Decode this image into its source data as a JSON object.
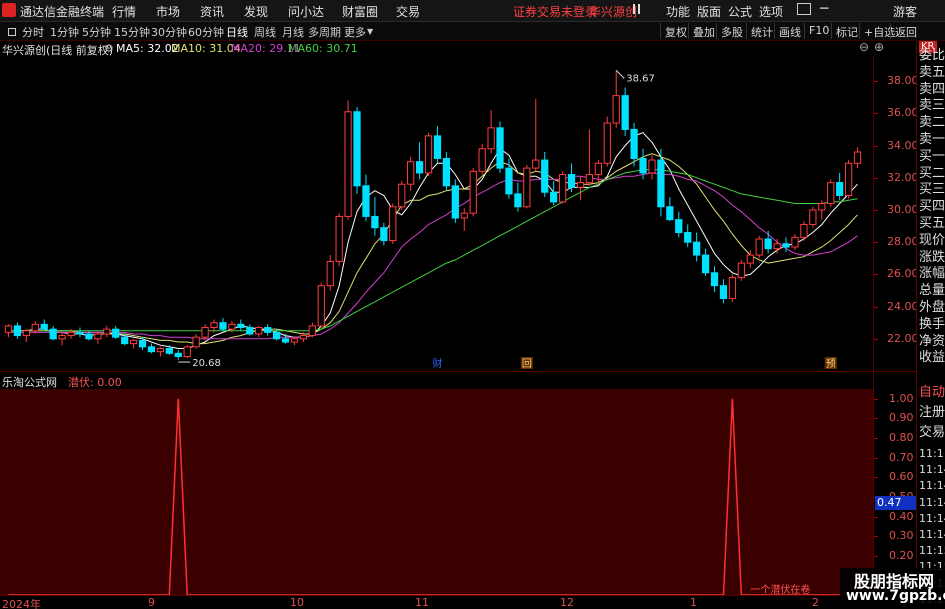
{
  "titlebar": {
    "app_name": "通达信金融终端",
    "menus": [
      "行情",
      "市场",
      "资讯",
      "发现",
      "问小达",
      "财富圈",
      "交易"
    ],
    "alert": "证券交易未登录",
    "stock_name": "华兴源创",
    "right_menus": [
      "功能",
      "版面",
      "公式",
      "选项"
    ],
    "guest": "游客"
  },
  "toolbar": {
    "periods": [
      "分时",
      "1分钟",
      "5分钟",
      "15分钟",
      "30分钟",
      "60分钟",
      "日线",
      "周线",
      "月线",
      "多周期",
      "更多"
    ],
    "active_period": "日线",
    "right_buttons": [
      "复权",
      "叠加",
      "多股",
      "统计",
      "画线",
      "F10",
      "标记",
      "+自选",
      "返回"
    ]
  },
  "main_chart": {
    "title": "华兴源创(日线 前复权)",
    "ma5": "MA5: 32.02",
    "ma10": "MA10: 31.04",
    "ma20": "MA20: 29.11",
    "ma60": "MA60: 30.71",
    "high_label": "38.67",
    "low_label": "20.68",
    "markers": [
      "财",
      "回",
      "预"
    ],
    "y_ticks": [
      "38.00",
      "36.00",
      "34.00",
      "32.00",
      "30.00",
      "28.00",
      "26.00",
      "24.00",
      "22.00"
    ],
    "colors": {
      "ma5": "#ffffff",
      "ma10": "#e0e070",
      "ma20": "#d040d0",
      "ma60": "#40d040",
      "up": "#ff3c3c",
      "down": "#00e0ff"
    }
  },
  "sub_chart": {
    "title": "乐淘公式网",
    "series_label": "潜伏: 0.00",
    "y_ticks": [
      "1.00",
      "0.90",
      "0.80",
      "0.70",
      "0.60",
      "0.50",
      "0.40",
      "0.30",
      "0.20"
    ],
    "current_value": "0.47",
    "annotation": "一个潜伏在卷"
  },
  "x_axis": {
    "labels": [
      "2024年",
      "9",
      "10",
      "11",
      "12",
      "1",
      "2"
    ]
  },
  "right_panel": {
    "header": "KR",
    "items": [
      "委比",
      "卖五",
      "卖四",
      "卖三",
      "卖二",
      "卖一",
      "买一",
      "买二",
      "买三",
      "买四",
      "买五",
      "现价",
      "涨跌",
      "涨幅",
      "总量",
      "外盘",
      "换手",
      "净资",
      "收益"
    ],
    "items2": [
      "自动",
      "注册",
      "交易"
    ],
    "times": [
      "11:1",
      "11:14",
      "11:14",
      "11:14",
      "11:14",
      "11:14",
      "11:15",
      "11:15",
      "11:15",
      "11:15"
    ]
  },
  "watermark": {
    "line1": "股朋指标网",
    "line2": "www.7gpzb.com"
  },
  "chart_data": {
    "type": "candlestick",
    "ylim": [
      20.0,
      39.5
    ],
    "candles": [
      [
        22.4,
        22.9,
        22.1,
        22.8
      ],
      [
        22.8,
        23.0,
        22.0,
        22.2
      ],
      [
        22.2,
        22.6,
        21.8,
        22.5
      ],
      [
        22.5,
        23.1,
        22.3,
        22.9
      ],
      [
        22.9,
        23.2,
        22.5,
        22.6
      ],
      [
        22.6,
        22.8,
        21.9,
        22.0
      ],
      [
        22.0,
        22.4,
        21.6,
        22.2
      ],
      [
        22.2,
        22.6,
        22.0,
        22.4
      ],
      [
        22.4,
        22.7,
        22.1,
        22.3
      ],
      [
        22.3,
        22.5,
        21.9,
        22.0
      ],
      [
        22.0,
        22.4,
        21.7,
        22.3
      ],
      [
        22.3,
        22.8,
        22.1,
        22.6
      ],
      [
        22.6,
        22.8,
        22.0,
        22.1
      ],
      [
        22.1,
        22.3,
        21.6,
        21.7
      ],
      [
        21.7,
        22.0,
        21.4,
        21.9
      ],
      [
        21.9,
        22.1,
        21.3,
        21.5
      ],
      [
        21.5,
        21.7,
        21.1,
        21.2
      ],
      [
        21.2,
        21.5,
        20.9,
        21.4
      ],
      [
        21.4,
        21.6,
        21.0,
        21.1
      ],
      [
        21.1,
        21.3,
        20.68,
        20.9
      ],
      [
        20.9,
        21.6,
        20.8,
        21.5
      ],
      [
        21.5,
        22.3,
        21.4,
        22.1
      ],
      [
        22.1,
        22.9,
        21.9,
        22.7
      ],
      [
        22.7,
        23.2,
        22.4,
        23.0
      ],
      [
        23.0,
        23.3,
        22.5,
        22.6
      ],
      [
        22.6,
        23.1,
        22.4,
        22.9
      ],
      [
        22.9,
        23.2,
        22.5,
        22.7
      ],
      [
        22.7,
        22.9,
        22.2,
        22.3
      ],
      [
        22.3,
        22.8,
        22.1,
        22.7
      ],
      [
        22.7,
        22.9,
        22.2,
        22.4
      ],
      [
        22.4,
        22.6,
        21.9,
        22.0
      ],
      [
        22.0,
        22.3,
        21.7,
        21.8
      ],
      [
        21.8,
        22.1,
        21.6,
        22.0
      ],
      [
        22.0,
        22.4,
        21.8,
        22.2
      ],
      [
        22.2,
        23.0,
        22.1,
        22.8
      ],
      [
        22.8,
        25.5,
        22.7,
        25.3
      ],
      [
        25.3,
        27.2,
        25.0,
        26.8
      ],
      [
        26.8,
        29.8,
        26.5,
        29.6
      ],
      [
        29.6,
        36.8,
        29.4,
        36.1
      ],
      [
        36.1,
        36.4,
        31.0,
        31.5
      ],
      [
        31.5,
        32.2,
        29.3,
        29.6
      ],
      [
        29.6,
        30.8,
        28.4,
        28.9
      ],
      [
        28.9,
        29.2,
        27.8,
        28.1
      ],
      [
        28.1,
        30.4,
        27.9,
        30.2
      ],
      [
        30.2,
        31.8,
        30.0,
        31.6
      ],
      [
        31.6,
        33.3,
        31.2,
        33.0
      ],
      [
        33.0,
        34.2,
        31.9,
        32.3
      ],
      [
        32.3,
        34.8,
        32.1,
        34.6
      ],
      [
        34.6,
        35.2,
        32.9,
        33.2
      ],
      [
        33.2,
        33.6,
        31.2,
        31.5
      ],
      [
        31.5,
        31.9,
        29.2,
        29.5
      ],
      [
        29.5,
        30.1,
        28.7,
        29.8
      ],
      [
        29.8,
        32.6,
        29.6,
        32.4
      ],
      [
        32.4,
        34.1,
        32.2,
        33.8
      ],
      [
        33.8,
        36.2,
        33.5,
        35.1
      ],
      [
        35.1,
        35.5,
        32.3,
        32.6
      ],
      [
        32.6,
        33.2,
        30.7,
        31.0
      ],
      [
        31.0,
        31.7,
        29.9,
        30.2
      ],
      [
        30.2,
        32.8,
        30.1,
        32.6
      ],
      [
        32.6,
        36.9,
        32.4,
        33.1
      ],
      [
        33.1,
        33.6,
        30.8,
        31.1
      ],
      [
        31.1,
        31.8,
        30.3,
        30.5
      ],
      [
        30.5,
        32.4,
        30.4,
        32.2
      ],
      [
        32.2,
        32.9,
        31.1,
        31.4
      ],
      [
        31.4,
        32.1,
        30.6,
        31.7
      ],
      [
        31.7,
        35.0,
        31.5,
        32.2
      ],
      [
        32.2,
        33.1,
        31.6,
        32.9
      ],
      [
        32.9,
        35.8,
        32.7,
        35.4
      ],
      [
        35.4,
        38.67,
        35.1,
        37.1
      ],
      [
        37.1,
        37.6,
        34.6,
        35.0
      ],
      [
        35.0,
        35.4,
        32.7,
        33.2
      ],
      [
        33.2,
        33.8,
        31.9,
        32.3
      ],
      [
        32.3,
        33.4,
        31.9,
        33.1
      ],
      [
        33.1,
        33.8,
        29.6,
        30.2
      ],
      [
        30.2,
        30.8,
        29.3,
        29.4
      ],
      [
        29.4,
        29.9,
        28.3,
        28.6
      ],
      [
        28.6,
        29.1,
        27.7,
        28.0
      ],
      [
        28.0,
        28.6,
        26.8,
        27.2
      ],
      [
        27.2,
        27.6,
        25.9,
        26.1
      ],
      [
        26.1,
        26.5,
        24.9,
        25.3
      ],
      [
        25.3,
        25.7,
        24.2,
        24.5
      ],
      [
        24.5,
        26.0,
        24.3,
        25.8
      ],
      [
        25.8,
        26.9,
        25.6,
        26.7
      ],
      [
        26.7,
        27.5,
        26.4,
        27.2
      ],
      [
        27.2,
        28.4,
        27.0,
        28.2
      ],
      [
        28.2,
        28.7,
        27.3,
        27.6
      ],
      [
        27.6,
        28.2,
        27.3,
        27.9
      ],
      [
        27.9,
        28.3,
        27.4,
        27.7
      ],
      [
        27.7,
        28.5,
        27.5,
        28.3
      ],
      [
        28.3,
        29.3,
        28.1,
        29.1
      ],
      [
        29.1,
        30.2,
        28.9,
        30.0
      ],
      [
        30.0,
        30.6,
        29.4,
        30.4
      ],
      [
        30.4,
        31.9,
        30.2,
        31.7
      ],
      [
        31.7,
        32.3,
        30.6,
        30.9
      ],
      [
        30.9,
        33.1,
        30.7,
        32.9
      ],
      [
        32.9,
        33.9,
        32.6,
        33.6
      ]
    ],
    "ma_series": [
      {
        "name": "MA5",
        "values": [
          22.5,
          22.5,
          22.5,
          22.6,
          22.6,
          22.4,
          22.4,
          22.3,
          22.3,
          22.2,
          22.3,
          22.3,
          22.3,
          22.2,
          22.1,
          22.0,
          21.8,
          21.6,
          21.5,
          21.4,
          21.4,
          21.6,
          21.8,
          22.2,
          22.4,
          22.6,
          22.8,
          22.7,
          22.6,
          22.6,
          22.4,
          22.2,
          22.1,
          22.1,
          22.2,
          22.8,
          23.6,
          25.3,
          28.0,
          29.9,
          30.8,
          31.2,
          30.9,
          30.0,
          29.7,
          30.4,
          31.4,
          32.3,
          32.9,
          32.9,
          32.2,
          31.3,
          31.3,
          31.9,
          32.9,
          33.8,
          33.4,
          32.3,
          32.1,
          32.1,
          31.8,
          31.1,
          31.1,
          31.4,
          31.4,
          31.4,
          31.5,
          32.1,
          33.3,
          34.0,
          34.6,
          34.8,
          34.2,
          33.3,
          32.5,
          31.3,
          30.3,
          29.3,
          28.3,
          27.3,
          26.6,
          26.1,
          25.9,
          26.0,
          26.5,
          27.1,
          27.5,
          27.8,
          27.9,
          28.2,
          28.6,
          29.1,
          29.8,
          30.4,
          31.0,
          31.6
        ]
      },
      {
        "name": "MA10",
        "values": [
          22.5,
          22.5,
          22.5,
          22.5,
          22.5,
          22.5,
          22.5,
          22.5,
          22.4,
          22.4,
          22.4,
          22.4,
          22.3,
          22.3,
          22.2,
          22.1,
          22.0,
          21.9,
          21.9,
          21.8,
          21.8,
          21.7,
          21.7,
          21.8,
          21.9,
          22.1,
          22.2,
          22.4,
          22.5,
          22.6,
          22.6,
          22.5,
          22.4,
          22.3,
          22.3,
          22.6,
          23.0,
          23.7,
          24.9,
          26.1,
          27.0,
          27.9,
          28.5,
          29.4,
          30.3,
          30.6,
          30.6,
          30.9,
          31.0,
          31.2,
          31.3,
          31.3,
          31.6,
          32.1,
          32.6,
          33.0,
          32.8,
          32.3,
          32.2,
          32.4,
          32.3,
          31.9,
          31.7,
          31.7,
          31.6,
          31.6,
          31.7,
          32.0,
          32.4,
          32.7,
          33.0,
          33.3,
          33.5,
          33.3,
          33.1,
          32.7,
          32.2,
          31.6,
          30.8,
          30.0,
          29.3,
          28.5,
          27.8,
          27.2,
          26.9,
          26.7,
          26.8,
          26.9,
          27.0,
          27.1,
          27.4,
          27.7,
          28.1,
          28.6,
          29.1,
          29.7
        ]
      },
      {
        "name": "MA20",
        "values": [
          22.4,
          22.4,
          22.4,
          22.4,
          22.4,
          22.4,
          22.4,
          22.4,
          22.4,
          22.4,
          22.4,
          22.4,
          22.4,
          22.4,
          22.3,
          22.3,
          22.2,
          22.2,
          22.1,
          22.1,
          22.1,
          22.0,
          22.0,
          22.0,
          22.0,
          22.0,
          22.0,
          22.0,
          22.0,
          22.0,
          22.1,
          22.1,
          22.1,
          22.1,
          22.2,
          22.3,
          22.6,
          23.0,
          23.6,
          24.2,
          24.9,
          25.5,
          26.1,
          26.9,
          27.7,
          28.2,
          28.6,
          29.1,
          29.4,
          29.7,
          30.1,
          30.4,
          30.8,
          31.1,
          31.4,
          31.7,
          31.9,
          31.8,
          31.8,
          31.9,
          31.9,
          31.9,
          31.9,
          32.1,
          32.1,
          32.0,
          31.9,
          31.9,
          32.0,
          32.1,
          32.1,
          32.2,
          32.3,
          32.2,
          32.2,
          32.1,
          31.9,
          31.8,
          31.5,
          31.2,
          30.8,
          30.3,
          29.9,
          29.4,
          28.9,
          28.5,
          28.0,
          27.6,
          27.3,
          27.2,
          27.2,
          27.3,
          27.4,
          27.7,
          28.0,
          28.4
        ]
      },
      {
        "name": "MA60",
        "values": [
          22.5,
          22.5,
          22.5,
          22.5,
          22.5,
          22.5,
          22.5,
          22.5,
          22.5,
          22.5,
          22.5,
          22.5,
          22.5,
          22.5,
          22.5,
          22.5,
          22.5,
          22.5,
          22.5,
          22.5,
          22.5,
          22.5,
          22.5,
          22.5,
          22.5,
          22.5,
          22.5,
          22.5,
          22.5,
          22.5,
          22.5,
          22.5,
          22.5,
          22.5,
          22.5,
          22.6,
          22.8,
          23.1,
          23.4,
          23.7,
          24.0,
          24.3,
          24.6,
          24.9,
          25.2,
          25.5,
          25.8,
          26.1,
          26.4,
          26.7,
          26.9,
          27.2,
          27.5,
          27.8,
          28.1,
          28.4,
          28.7,
          29.0,
          29.3,
          29.6,
          29.9,
          30.2,
          30.5,
          30.8,
          31.1,
          31.4,
          31.6,
          31.9,
          32.1,
          32.3,
          32.4,
          32.5,
          32.5,
          32.5,
          32.4,
          32.3,
          32.2,
          32.0,
          31.8,
          31.6,
          31.4,
          31.2,
          31.0,
          30.9,
          30.8,
          30.7,
          30.6,
          30.5,
          30.4,
          30.4,
          30.4,
          30.4,
          30.5,
          30.5,
          30.6,
          30.7
        ]
      }
    ],
    "signal_spikes": [
      {
        "index": 19,
        "value": 1.0
      },
      {
        "index": 81,
        "value": 1.0
      }
    ],
    "signal_ylim": [
      0,
      1.05
    ],
    "marker_positions": [
      {
        "label": "财",
        "index": 48
      },
      {
        "label": "回",
        "index": 58
      },
      {
        "label": "预",
        "index": 92
      }
    ]
  }
}
